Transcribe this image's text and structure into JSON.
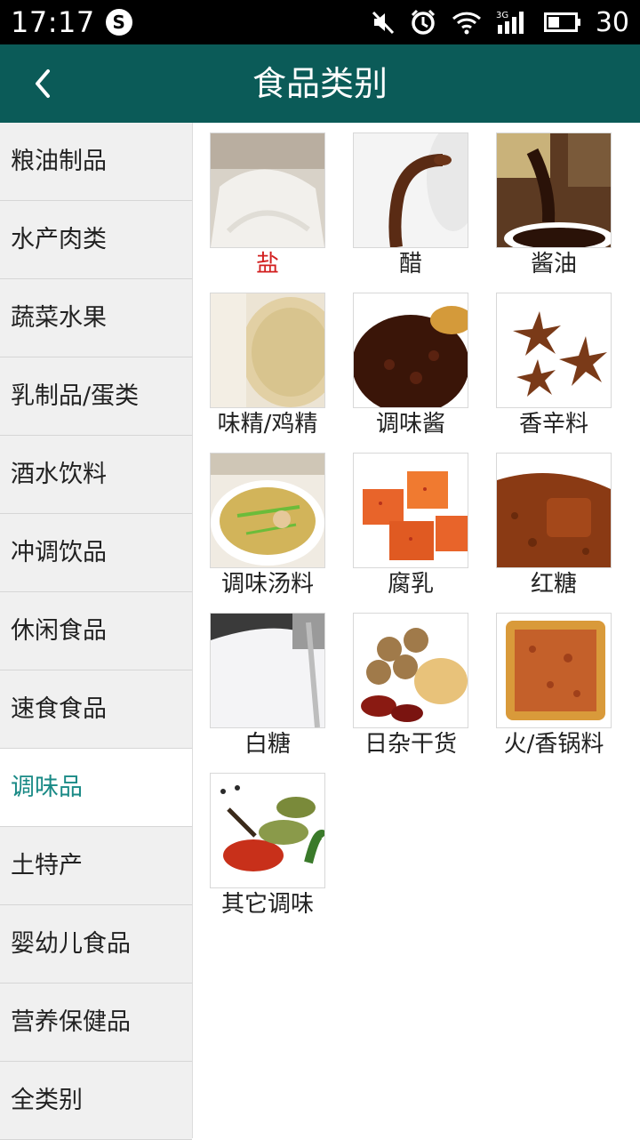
{
  "status_bar": {
    "time": "17:17",
    "battery": "30",
    "icons": [
      "app-notification-icon",
      "mute-icon",
      "alarm-icon",
      "wifi-icon",
      "signal-3g-icon",
      "battery-icon"
    ]
  },
  "header": {
    "title": "食品类别",
    "back_icon": "chevron-left-icon"
  },
  "sidebar": {
    "items": [
      {
        "label": "粮油制品"
      },
      {
        "label": "水产肉类"
      },
      {
        "label": "蔬菜水果"
      },
      {
        "label": "乳制品/蛋类"
      },
      {
        "label": "酒水饮料"
      },
      {
        "label": "冲调饮品"
      },
      {
        "label": "休闲食品"
      },
      {
        "label": "速食食品"
      },
      {
        "label": "调味品"
      },
      {
        "label": "土特产"
      },
      {
        "label": "婴幼儿食品"
      },
      {
        "label": "营养保健品"
      },
      {
        "label": "全类别"
      }
    ],
    "active": "调味品"
  },
  "grid": {
    "items": [
      {
        "label": "盐",
        "selected": true
      },
      {
        "label": "醋"
      },
      {
        "label": "酱油"
      },
      {
        "label": "味精/鸡精"
      },
      {
        "label": "调味酱"
      },
      {
        "label": "香辛料"
      },
      {
        "label": "调味汤料"
      },
      {
        "label": "腐乳"
      },
      {
        "label": "红糖"
      },
      {
        "label": "白糖"
      },
      {
        "label": "日杂干货"
      },
      {
        "label": "火/香锅料"
      },
      {
        "label": "其它调味"
      }
    ]
  },
  "colors": {
    "header": "#0b5b58",
    "active_sidebar_text": "#1a8a86",
    "selected_item_text": "#d21f1f"
  }
}
